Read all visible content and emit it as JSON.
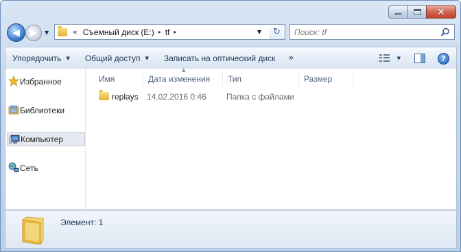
{
  "window": {
    "caption_buttons": [
      "minimize",
      "maximize",
      "close"
    ]
  },
  "navigation": {
    "breadcrumb": [
      "Съемный диск (E:)",
      "tf"
    ],
    "overflow_glyph": "«",
    "separator_glyph": "▸"
  },
  "search": {
    "placeholder": "Поиск: tf"
  },
  "toolbar": {
    "organize": "Упорядочить",
    "share": "Общий доступ",
    "burn": "Записать на оптический диск",
    "more": "»"
  },
  "nav_pane": {
    "favorites": "Избранное",
    "libraries": "Библиотеки",
    "computer": "Компьютер",
    "network": "Сеть"
  },
  "columns": {
    "name": "Имя",
    "date_modified": "Дата изменения",
    "type": "Тип",
    "size": "Размер"
  },
  "files": [
    {
      "name": "replays",
      "date_modified": "14.02.2016 0:46",
      "type": "Папка с файлами",
      "size": ""
    }
  ],
  "details": {
    "text": "Элемент: 1"
  },
  "colors": {
    "accent": "#3f7fd1",
    "folder": "#e2b236",
    "close_button": "#c3432c"
  }
}
